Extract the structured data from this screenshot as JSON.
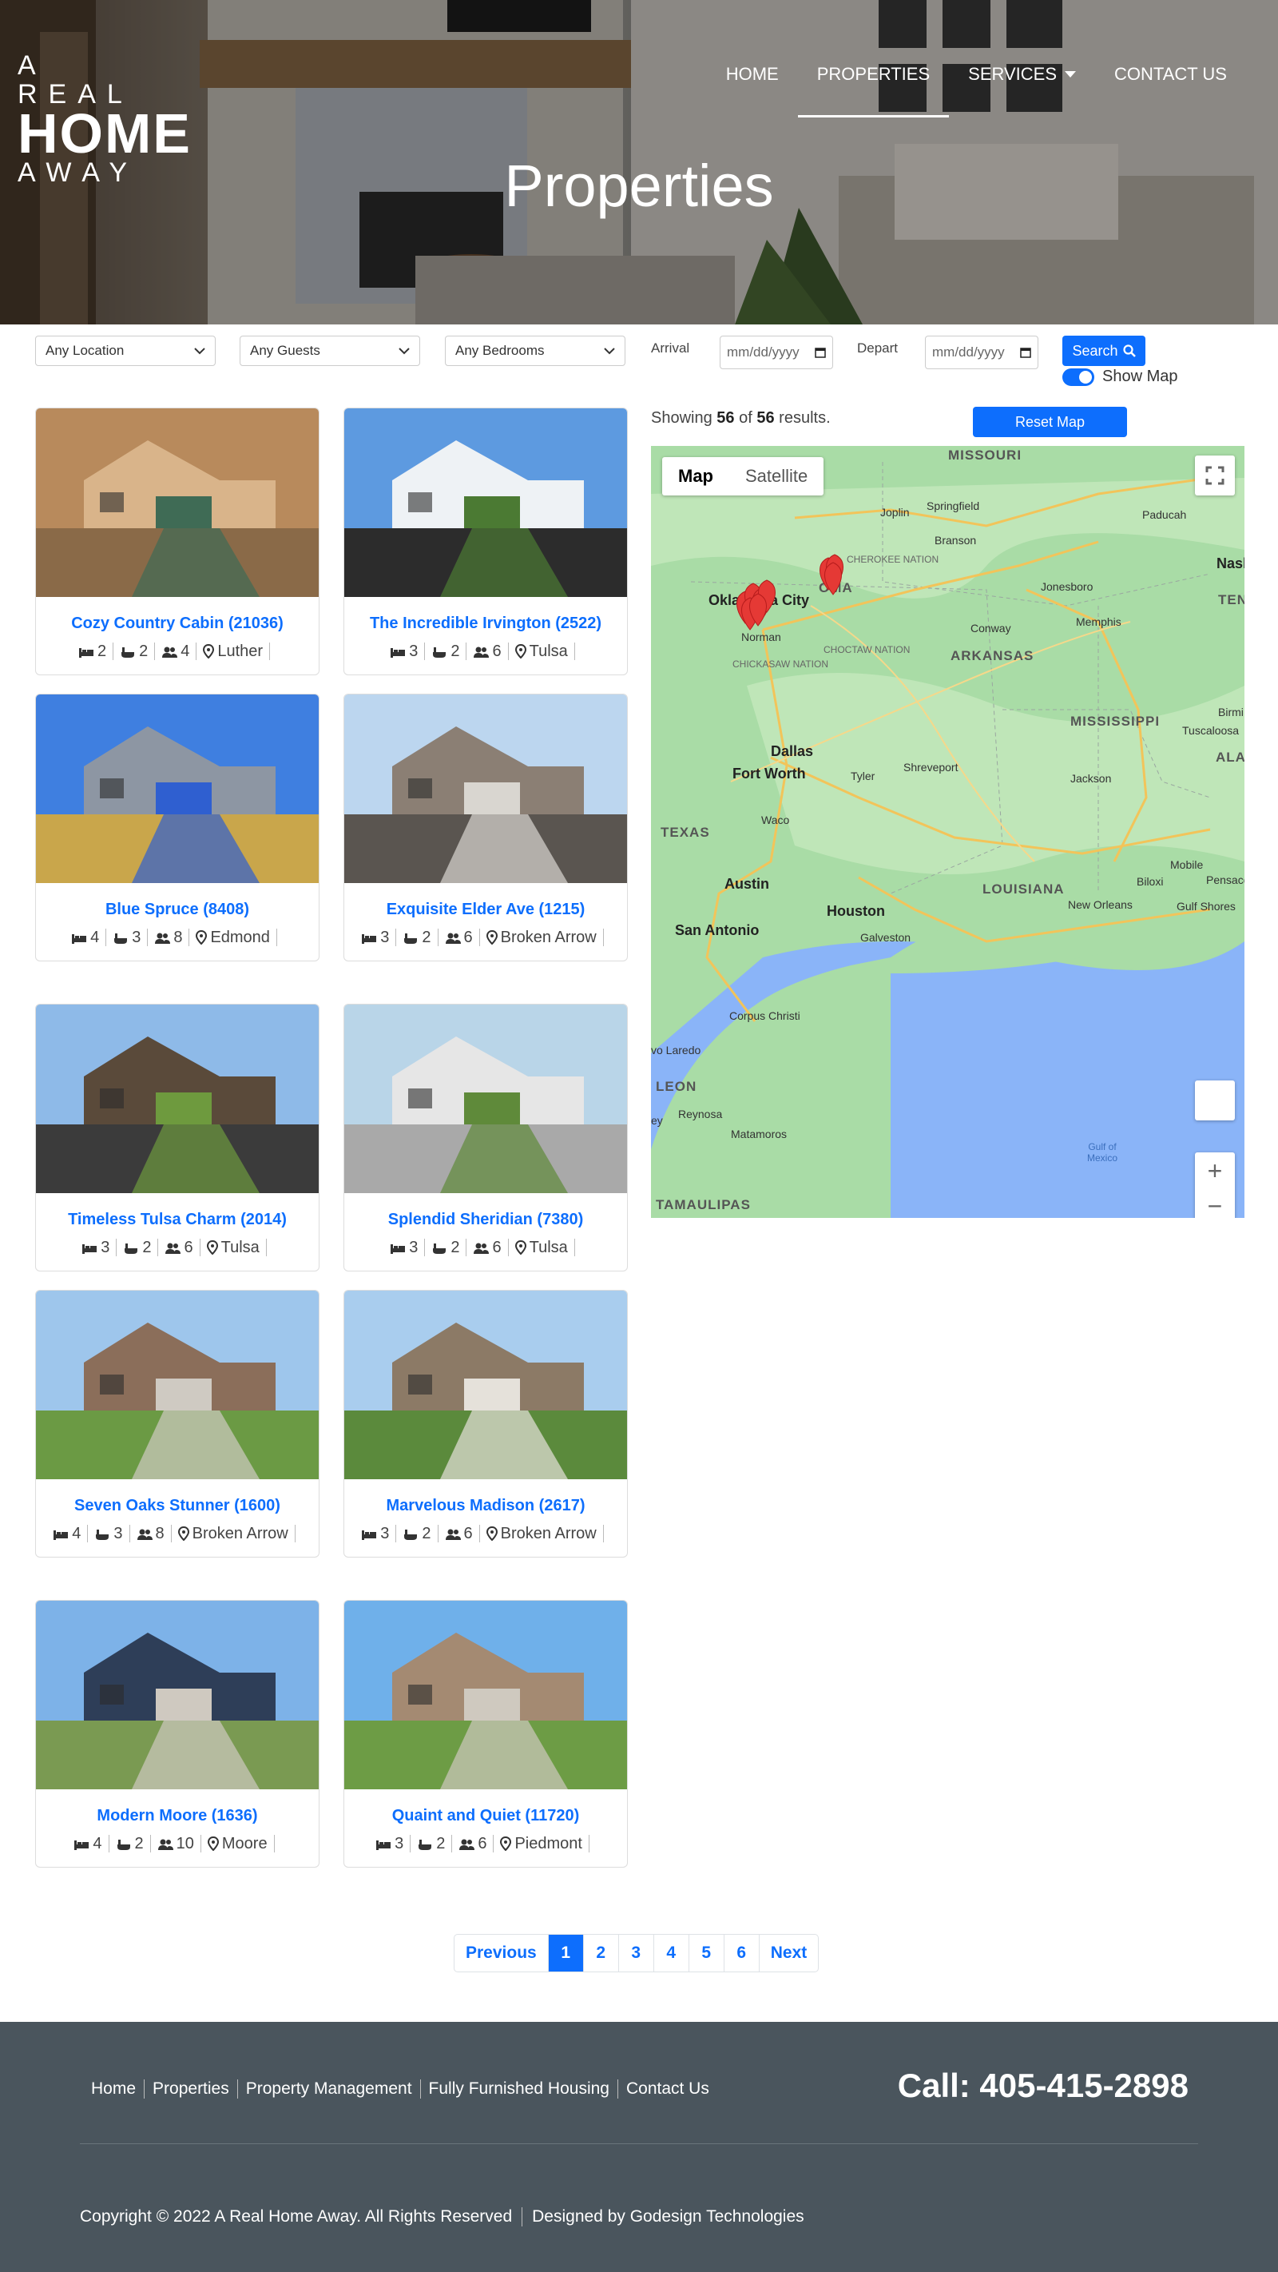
{
  "brand": {
    "line1": "A REAL",
    "line2": "HOME",
    "line3": "AWAY"
  },
  "nav": [
    {
      "label": "HOME"
    },
    {
      "label": "PROPERTIES"
    },
    {
      "label": "SERVICES"
    },
    {
      "label": "CONTACT US"
    }
  ],
  "hero": {
    "title": "Properties"
  },
  "filters": {
    "location": "Any Location",
    "guests": "Any Guests",
    "bedrooms": "Any Bedrooms",
    "arrival_label": "Arrival",
    "arrival_placeholder": "mm/dd/yyyy",
    "depart_label": "Depart",
    "depart_placeholder": "mm/dd/yyyy",
    "search_label": "Search",
    "show_map_label": "Show Map"
  },
  "results": {
    "prefix": "Showing",
    "shown": "56",
    "of": "of",
    "total": "56",
    "suffix": "results.",
    "reset_label": "Reset Map"
  },
  "properties": [
    {
      "title": "Cozy Country Cabin (21036)",
      "beds": "2",
      "baths": "2",
      "guests": "4",
      "city": "Luther"
    },
    {
      "title": "The Incredible Irvington (2522)",
      "beds": "3",
      "baths": "2",
      "guests": "6",
      "city": "Tulsa"
    },
    {
      "title": "Blue Spruce (8408)",
      "beds": "4",
      "baths": "3",
      "guests": "8",
      "city": "Edmond"
    },
    {
      "title": "Exquisite Elder Ave (1215)",
      "beds": "3",
      "baths": "2",
      "guests": "6",
      "city": "Broken Arrow"
    },
    {
      "title": "Timeless Tulsa Charm (2014)",
      "beds": "3",
      "baths": "2",
      "guests": "6",
      "city": "Tulsa"
    },
    {
      "title": "Splendid Sheridian (7380)",
      "beds": "3",
      "baths": "2",
      "guests": "6",
      "city": "Tulsa"
    },
    {
      "title": "Seven Oaks Stunner (1600)",
      "beds": "4",
      "baths": "3",
      "guests": "8",
      "city": "Broken Arrow"
    },
    {
      "title": "Marvelous Madison (2617)",
      "beds": "3",
      "baths": "2",
      "guests": "6",
      "city": "Broken Arrow"
    },
    {
      "title": "Modern Moore (1636)",
      "beds": "4",
      "baths": "2",
      "guests": "10",
      "city": "Moore"
    },
    {
      "title": "Quaint and Quiet (11720)",
      "beds": "3",
      "baths": "2",
      "guests": "6",
      "city": "Piedmont"
    }
  ],
  "map": {
    "type_map": "Map",
    "type_satellite": "Satellite",
    "labels": {
      "missouri": "MISSOURI",
      "joplin": "Joplin",
      "springfield": "Springfield",
      "branson": "Branson",
      "paducah": "Paducah",
      "nashville": "Nash",
      "cherokee": "CHEROKEE NATION",
      "okc": "Oklahoma City",
      "oklahoma": "OMA",
      "norman": "Norman",
      "tenn": "TENN",
      "jonesboro": "Jonesboro",
      "conway": "Conway",
      "memphis": "Memphis",
      "chickasaw": "CHICKASAW NATION",
      "choctaw": "CHOCTAW NATION",
      "arkansas": "ARKANSAS",
      "mississippi": "MISSISSIPPI",
      "birmingham": "Birmi",
      "tuscaloosa": "Tuscaloosa",
      "ala": "ALA",
      "dallas": "Dallas",
      "fortworth": "Fort Worth",
      "tyler": "Tyler",
      "shreveport": "Shreveport",
      "jackson": "Jackson",
      "texas": "TEXAS",
      "waco": "Waco",
      "austin": "Austin",
      "louisiana": "LOUISIANA",
      "houston": "Houston",
      "mobile": "Mobile",
      "biloxi": "Biloxi",
      "pensacola": "Pensaco",
      "neworleans": "New Orleans",
      "gulfshores": "Gulf Shores",
      "sanantonio": "San Antonio",
      "galveston": "Galveston",
      "corpus": "Corpus Christi",
      "laredo": "vo Laredo",
      "leon": "LEON",
      "reynosa": "Reynosa",
      "matamoros": "Matamoros",
      "ey": "ey",
      "gulf": "Gulf of Mexico",
      "tamaulipas": "TAMAULIPAS"
    }
  },
  "pagination": [
    "Previous",
    "1",
    "2",
    "3",
    "4",
    "5",
    "6",
    "Next"
  ],
  "footer": {
    "links": [
      "Home",
      "Properties",
      "Property Management",
      "Fully Furnished Housing",
      "Contact Us"
    ],
    "phone": "Call: 405-415-2898",
    "copyright": "Copyright © 2022 A Real Home Away. All Rights Reserved",
    "designer": "Designed by Godesign Technologies"
  },
  "colors": {
    "accent": "#0d6efd",
    "footer_bg": "#4a555d",
    "map_land": "#a9dca6",
    "map_water": "#8ab4f8",
    "marker": "#e53935"
  },
  "icons": {
    "bed": "bed-icon",
    "bath": "bath-icon",
    "guests": "users-icon",
    "location": "map-marker-icon"
  }
}
